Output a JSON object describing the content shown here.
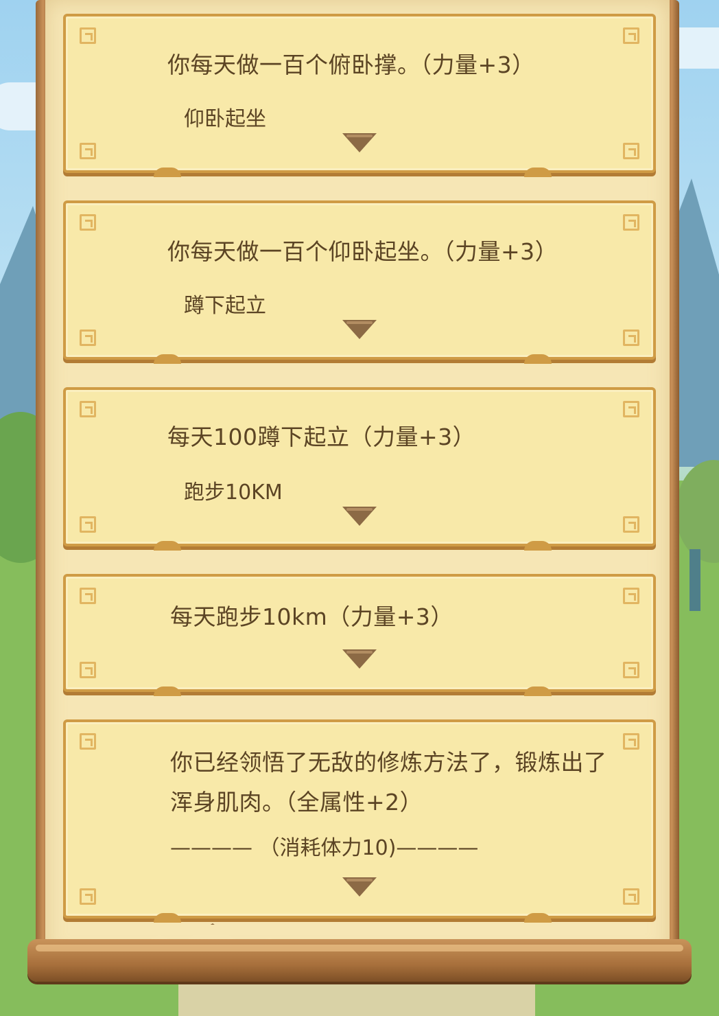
{
  "colors": {
    "card_bg": "#f8e9a9",
    "card_border": "#cf9b45",
    "text": "#5b4424",
    "arrow": "#8c6a45",
    "scroll_wood": "#a8703c"
  },
  "cards": [
    {
      "title": "你每天做一百个俯卧撑。（力量+3）",
      "option": "仰卧起坐",
      "icon": "chevron-down-icon"
    },
    {
      "title": "你每天做一百个仰卧起坐。（力量+3）",
      "option": "蹲下起立",
      "icon": "chevron-down-icon"
    },
    {
      "title": "每天100蹲下起立（力量+3）",
      "option": "跑步10KM",
      "icon": "chevron-down-icon"
    },
    {
      "title": "每天跑步10km（力量+3）",
      "option": "",
      "icon": "chevron-down-icon"
    },
    {
      "title": "你已经领悟了无敌的修炼方法了，锻炼出了浑身肌肉。（全属性+2）",
      "cost_line": "———— （消耗体力10)————",
      "icon": "chevron-down-icon"
    }
  ]
}
